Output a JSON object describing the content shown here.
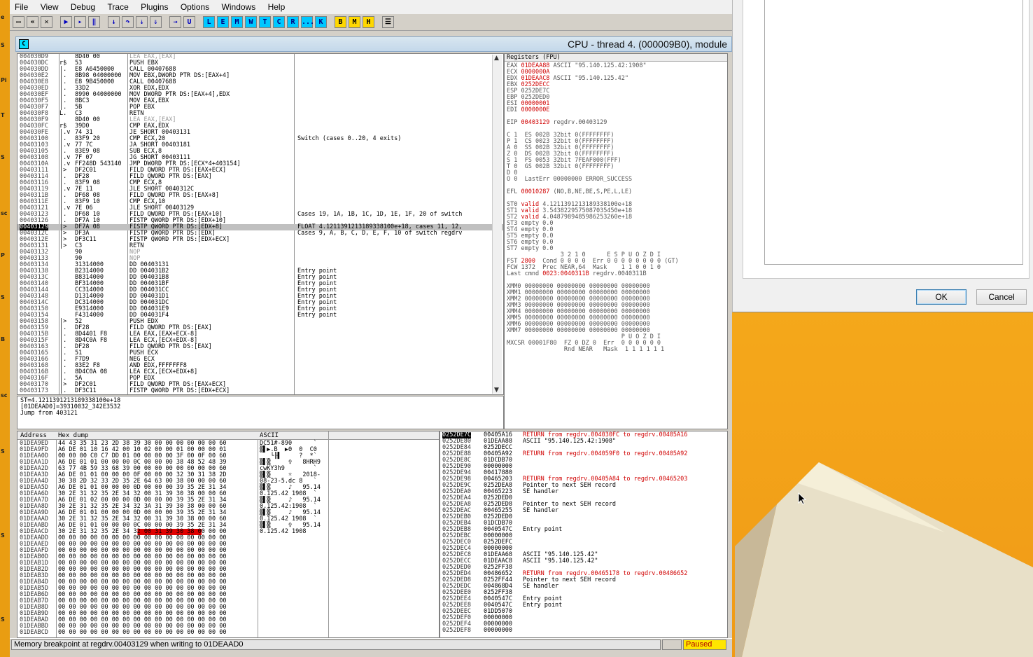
{
  "menu": [
    "File",
    "View",
    "Debug",
    "Trace",
    "Plugins",
    "Options",
    "Windows",
    "Help"
  ],
  "toolbar": {
    "letters": [
      "L",
      "E",
      "M",
      "W",
      "T",
      "C",
      "R",
      "...",
      "K"
    ],
    "letters2": [
      "B",
      "M",
      "H"
    ]
  },
  "window": {
    "icon_letter": "C",
    "title": "CPU - thread 4. (000009B0), module"
  },
  "disasm": [
    {
      "a": "004030D9",
      "m": "",
      "h": "8D40 00",
      "c": "LEA EAX,[EAX]",
      "n": "",
      "s": "grey"
    },
    {
      "a": "004030DC",
      "m": "r$",
      "h": "53",
      "c": "PUSH EBX",
      "n": ""
    },
    {
      "a": "004030DD",
      "m": "|.",
      "h": "E8 A6450000",
      "c": "CALL 00407688",
      "n": ""
    },
    {
      "a": "004030E2",
      "m": "|.",
      "h": "8B98 04000000",
      "c": "MOV EBX,DWORD PTR DS:[EAX+4]",
      "n": ""
    },
    {
      "a": "004030E8",
      "m": "|.",
      "h": "E8 9B450000",
      "c": "CALL 00407688",
      "n": ""
    },
    {
      "a": "004030ED",
      "m": "|.",
      "h": "33D2",
      "c": "XOR EDX,EDX",
      "n": ""
    },
    {
      "a": "004030EF",
      "m": "|.",
      "h": "8990 04000000",
      "c": "MOV DWORD PTR DS:[EAX+4],EDX",
      "n": ""
    },
    {
      "a": "004030F5",
      "m": "|.",
      "h": "8BC3",
      "c": "MOV EAX,EBX",
      "n": ""
    },
    {
      "a": "004030F7",
      "m": "|.",
      "h": "5B",
      "c": "POP EBX",
      "n": ""
    },
    {
      "a": "004030F8",
      "m": "L.",
      "h": "C3",
      "c": "RETN",
      "n": ""
    },
    {
      "a": "004030F9",
      "m": "",
      "h": "8D40 00",
      "c": "LEA EAX,[EAX]",
      "n": "",
      "s": "grey"
    },
    {
      "a": "004030FC",
      "m": "r$",
      "h": "39D0",
      "c": "CMP EAX,EDX",
      "n": ""
    },
    {
      "a": "004030FE",
      "m": "|.v",
      "h": "74 31",
      "c": "JE SHORT 00403131",
      "n": ""
    },
    {
      "a": "00403100",
      "m": "|.",
      "h": "83F9 20",
      "c": "CMP ECX,20",
      "n": "Switch (cases 0..20, 4 exits)"
    },
    {
      "a": "00403103",
      "m": "|.v",
      "h": "77 7C",
      "c": "JA SHORT 00403181",
      "n": ""
    },
    {
      "a": "00403105",
      "m": "|.",
      "h": "83E9 08",
      "c": "SUB ECX,8",
      "n": ""
    },
    {
      "a": "00403108",
      "m": "|.v",
      "h": "7F 07",
      "c": "JG SHORT 00403111",
      "n": ""
    },
    {
      "a": "0040310A",
      "m": "|.v",
      "h": "FF248D 543140",
      "c": "JMP DWORD PTR DS:[ECX*4+403154]",
      "n": ""
    },
    {
      "a": "00403111",
      "m": "|>",
      "h": "DF2C01",
      "c": "FILD QWORD PTR DS:[EAX+ECX]",
      "n": ""
    },
    {
      "a": "00403114",
      "m": "|.",
      "h": "DF28",
      "c": "FILD QWORD PTR DS:[EAX]",
      "n": ""
    },
    {
      "a": "00403116",
      "m": "|.",
      "h": "83F9 08",
      "c": "CMP ECX,8",
      "n": ""
    },
    {
      "a": "00403119",
      "m": "|.v",
      "h": "7E 11",
      "c": "JLE SHORT 0040312C",
      "n": ""
    },
    {
      "a": "0040311B",
      "m": "|.",
      "h": "DF68 08",
      "c": "FILD QWORD PTR DS:[EAX+8]",
      "n": ""
    },
    {
      "a": "0040311E",
      "m": "|.",
      "h": "83F9 10",
      "c": "CMP ECX,10",
      "n": ""
    },
    {
      "a": "00403121",
      "m": "|.v",
      "h": "7E 06",
      "c": "JLE SHORT 00403129",
      "n": ""
    },
    {
      "a": "00403123",
      "m": "|.",
      "h": "DF68 10",
      "c": "FILD QWORD PTR DS:[EAX+10]",
      "n": "Cases 19, 1A, 1B, 1C, 1D, 1E, 1F, 20 of switch"
    },
    {
      "a": "00403126",
      "m": "|.",
      "h": "DF7A 10",
      "c": "FISTP QWORD PTR DS:[EDX+10]",
      "n": ""
    },
    {
      "a": "00403129",
      "m": "|>",
      "h": "DF7A 08",
      "c": "FISTP QWORD PTR DS:[EDX+8]",
      "n": "FLOAT 4.1211391213189338100e+18, cases 11, 12,",
      "hl": true
    },
    {
      "a": "0040312C",
      "m": "|>",
      "h": "DF3A",
      "c": "FISTP QWORD PTR DS:[EDX]",
      "n": "Cases 9, A, B, C, D, E, F, 10 of switch regdrv"
    },
    {
      "a": "0040312E",
      "m": "|>",
      "h": "DF3C11",
      "c": "FISTP QWORD PTR DS:[EDX+ECX]",
      "n": ""
    },
    {
      "a": "00403131",
      "m": "|>",
      "h": "C3",
      "c": "RETN",
      "n": ""
    },
    {
      "a": "00403132",
      "m": "",
      "h": "90",
      "c": "NOP",
      "n": "",
      "s": "grey"
    },
    {
      "a": "00403133",
      "m": "",
      "h": "90",
      "c": "NOP",
      "n": "",
      "s": "grey"
    },
    {
      "a": "00403134",
      "m": "",
      "h": "31314000",
      "c": "DD 00403131",
      "n": ""
    },
    {
      "a": "00403138",
      "m": "",
      "h": "B2314000",
      "c": "DD 004031B2",
      "n": "Entry point"
    },
    {
      "a": "0040313C",
      "m": "",
      "h": "B8314000",
      "c": "DD 004031B8",
      "n": "Entry point"
    },
    {
      "a": "00403140",
      "m": "",
      "h": "BF314000",
      "c": "DD 004031BF",
      "n": "Entry point"
    },
    {
      "a": "00403144",
      "m": "",
      "h": "CC314000",
      "c": "DD 004031CC",
      "n": "Entry point"
    },
    {
      "a": "00403148",
      "m": "",
      "h": "D1314000",
      "c": "DD 004031D1",
      "n": "Entry point"
    },
    {
      "a": "0040314C",
      "m": "",
      "h": "DC314000",
      "c": "DD 004031DC",
      "n": "Entry point"
    },
    {
      "a": "00403150",
      "m": "",
      "h": "E9314000",
      "c": "DD 004031E9",
      "n": "Entry point"
    },
    {
      "a": "00403154",
      "m": "",
      "h": "F4314000",
      "c": "DD 004031F4",
      "n": "Entry point"
    },
    {
      "a": "00403158",
      "m": "|>",
      "h": "52",
      "c": "PUSH EDX",
      "n": ""
    },
    {
      "a": "00403159",
      "m": "|.",
      "h": "DF28",
      "c": "FILD QWORD PTR DS:[EAX]",
      "n": ""
    },
    {
      "a": "0040315B",
      "m": "|.",
      "h": "8D4401 F8",
      "c": "LEA EAX,[EAX+ECX-8]",
      "n": ""
    },
    {
      "a": "0040315F",
      "m": "|.",
      "h": "8D4C0A F8",
      "c": "LEA ECX,[ECX+EDX-8]",
      "n": ""
    },
    {
      "a": "00403163",
      "m": "|.",
      "h": "DF28",
      "c": "FILD QWORD PTR DS:[EAX]",
      "n": ""
    },
    {
      "a": "00403165",
      "m": "|.",
      "h": "51",
      "c": "PUSH ECX",
      "n": ""
    },
    {
      "a": "00403166",
      "m": "|.",
      "h": "F7D9",
      "c": "NEG ECX",
      "n": ""
    },
    {
      "a": "00403168",
      "m": "|.",
      "h": "83E2 F8",
      "c": "AND EDX,FFFFFFF8",
      "n": ""
    },
    {
      "a": "0040316B",
      "m": "|.",
      "h": "8D4C0A 08",
      "c": "LEA ECX,[ECX+EDX+8]",
      "n": ""
    },
    {
      "a": "0040316F",
      "m": "|.",
      "h": "5A",
      "c": "POP EDX",
      "n": ""
    },
    {
      "a": "00403170",
      "m": "|>",
      "h": "DF2C01",
      "c": "FILD QWORD PTR DS:[EAX+ECX]",
      "n": ""
    },
    {
      "a": "00403173",
      "m": "|.",
      "h": "DF3C11",
      "c": "FISTP QWORD PTR DS:[EDX+ECX]",
      "n": ""
    }
  ],
  "info": [
    "ST=4.1211391213189338100e+18",
    "[01DEAAD0]=39310032_342E3532",
    "Jump from 403121"
  ],
  "registers": {
    "header": "Registers (FPU)",
    "lines": [
      {
        "t": "EAX ",
        "v": "01DEAA88",
        "r": " ASCII \"95.140.125.42:1908\""
      },
      {
        "t": "ECX ",
        "v": "0000000A",
        "r": ""
      },
      {
        "t": "EDX ",
        "v": "01DEAAC8",
        "r": " ASCII \"95.140.125.42\""
      },
      {
        "t": "EBX ",
        "v": "0252DECC",
        "r": ""
      },
      {
        "t": "ESP 0252DE7C",
        "v": "",
        "r": ""
      },
      {
        "t": "EBP 0252DED0",
        "v": "",
        "r": ""
      },
      {
        "t": "ESI ",
        "v": "00000001",
        "r": ""
      },
      {
        "t": "EDI ",
        "v": "0000000E",
        "r": ""
      },
      {
        "t": "",
        "v": "",
        "r": ""
      },
      {
        "t": "EIP ",
        "v": "00403129",
        "r": " regdrv.00403129"
      },
      {
        "t": "",
        "v": "",
        "r": ""
      },
      {
        "t": "C 1  ES 002B 32bit 0(FFFFFFFF)",
        "v": "",
        "r": ""
      },
      {
        "t": "P 1  CS 0023 32bit 0(FFFFFFFF)",
        "v": "",
        "r": ""
      },
      {
        "t": "A 0  SS 002B 32bit 0(FFFFFFFF)",
        "v": "",
        "r": ""
      },
      {
        "t": "Z 0  DS 002B 32bit 0(FFFFFFFF)",
        "v": "",
        "r": ""
      },
      {
        "t": "S 1  FS 0053 32bit 7FEAF000(FFF)",
        "v": "",
        "r": ""
      },
      {
        "t": "T 0  GS 002B 32bit 0(FFFFFFFF)",
        "v": "",
        "r": ""
      },
      {
        "t": "D 0",
        "v": "",
        "r": ""
      },
      {
        "t": "O 0  LastErr 00000000 ERROR_SUCCESS",
        "v": "",
        "r": ""
      },
      {
        "t": "",
        "v": "",
        "r": ""
      },
      {
        "t": "EFL ",
        "v": "00010287",
        "r": " (NO,B,NE,BE,S,PE,L,LE)"
      },
      {
        "t": "",
        "v": "",
        "r": ""
      },
      {
        "t": "ST0 ",
        "v": "valid",
        "r": " 4.1211391213189338100e+18"
      },
      {
        "t": "ST1 ",
        "v": "valid",
        "r": " 3.5438229575087035450e+18"
      },
      {
        "t": "ST2 ",
        "v": "valid",
        "r": " 4.0487989485986253260e+18"
      },
      {
        "t": "ST3 empty 0.0",
        "v": "",
        "r": ""
      },
      {
        "t": "ST4 empty 0.0",
        "v": "",
        "r": ""
      },
      {
        "t": "ST5 empty 0.0",
        "v": "",
        "r": ""
      },
      {
        "t": "ST6 empty 0.0",
        "v": "",
        "r": ""
      },
      {
        "t": "ST7 empty 0.0",
        "v": "",
        "r": ""
      },
      {
        "t": "               3 2 1 0      E S P U O Z D I",
        "v": "",
        "r": ""
      },
      {
        "t": "FST ",
        "v": "2800",
        "r": "  Cond 0 0 0 0  Err 0 0 0 0 0 0 0 0 (GT)"
      },
      {
        "t": "FCW 1372  Prec NEAR,64  Mask    1 1 0 0 1 0",
        "v": "",
        "r": ""
      },
      {
        "t": "Last cmnd ",
        "v": "0023:0040311B",
        "r": " regdrv.0040311B"
      },
      {
        "t": "",
        "v": "",
        "r": ""
      },
      {
        "t": "XMM0 00000000 00000000 00000000 00000000",
        "v": "",
        "r": ""
      },
      {
        "t": "XMM1 00000000 00000000 00000000 00000000",
        "v": "",
        "r": ""
      },
      {
        "t": "XMM2 00000000 00000000 00000000 00000000",
        "v": "",
        "r": ""
      },
      {
        "t": "XMM3 00000000 00000000 00000000 00000000",
        "v": "",
        "r": ""
      },
      {
        "t": "XMM4 00000000 00000000 00000000 00000000",
        "v": "",
        "r": ""
      },
      {
        "t": "XMM5 00000000 00000000 00000000 00000000",
        "v": "",
        "r": ""
      },
      {
        "t": "XMM6 00000000 00000000 00000000 00000000",
        "v": "",
        "r": ""
      },
      {
        "t": "XMM7 00000000 00000000 00000000 00000000",
        "v": "",
        "r": ""
      },
      {
        "t": "                                P U O Z D I",
        "v": "",
        "r": ""
      },
      {
        "t": "MXCSR 00001F80  FZ 0 DZ 0  Err  0 0 0 0 0 0",
        "v": "",
        "r": ""
      },
      {
        "t": "                Rnd NEAR   Mask  1 1 1 1 1 1",
        "v": "",
        "r": ""
      }
    ]
  },
  "dump": {
    "headers": [
      "Address",
      "Hex dump",
      "ASCII"
    ],
    "rows": [
      {
        "a": "01DEA9ED",
        "h": "44 43 35 31 23 2D 38 39 30 00 00 00 00 00 00 60",
        "x": "DC51#-890      `"
      },
      {
        "a": "01DEA9FD",
        "h": "A6 DE 01 10 16 42 00 10 02 00 00 01 00 00 00 01",
        "x": "▒▌▶.B  ▶Θ  0  C0"
      },
      {
        "a": "01DEAA0D",
        "h": "00 00 00 C0 C7 DD 01 00 00 00 00 3F 00 0F 00 60",
        "x": "   └╟▌     ?  *`"
      },
      {
        "a": "01DEAA1D",
        "h": "A6 DE 01 01 00 00 00 0C 00 00 00 38 48 52 48 39",
        "x": "▒▌▒     ♀   8HRH9"
      },
      {
        "a": "01DEAA2D",
        "h": "63 77 4B 59 33 68 39 00 00 00 00 00 00 00 00 60",
        "x": "cwKY3h9        `"
      },
      {
        "a": "01DEAA3D",
        "h": "A6 DE 01 01 00 00 00 0F 00 00 00 32 30 31 38 2D",
        "x": "▒▌▒     ☼   2018-"
      },
      {
        "a": "01DEAA4D",
        "h": "30 38 2D 32 33 2D 35 2E 64 63 00 38 00 00 00 60",
        "x": "08-23-5.dc 8   `"
      },
      {
        "a": "01DEAA5D",
        "h": "A6 DE 01 01 00 00 00 0D 00 00 00 39 35 2E 31 34",
        "x": "▒▌▒     ♪   95.14"
      },
      {
        "a": "01DEAA6D",
        "h": "30 2E 31 32 35 2E 34 32 00 31 39 30 38 00 00 60",
        "x": "0.125.42 1908  `"
      },
      {
        "a": "01DEAA7D",
        "h": "A6 DE 01 02 00 00 00 0D 00 00 00 39 35 2E 31 34",
        "x": "▒▌▒     ♪   95.14"
      },
      {
        "a": "01DEAA8D",
        "h": "30 2E 31 32 35 2E 34 32 3A 31 39 30 38 00 00 60",
        "x": "0.125.42:1908  `"
      },
      {
        "a": "01DEAA9D",
        "h": "A6 DE 01 01 00 00 00 0D 00 00 00 39 35 2E 31 34",
        "x": "▒▌▒     ♪   95.14"
      },
      {
        "a": "01DEAAAD",
        "h": "30 2E 31 32 35 2E 34 32 00 31 39 30 38 00 00 60",
        "x": "0.125.42 1908  `"
      },
      {
        "a": "01DEAABD",
        "h": "A6 DE 01 01 00 00 00 0C 00 00 00 39 35 2E 31 34",
        "x": "▒▌▒     ♀   95.14"
      },
      {
        "a": "01DEAACD",
        "h": "30 2E 31 32 35 2E 34 32 00 31 39 30 38 00 00 00",
        "x": "0.125.42 1908   "
      },
      {
        "a": "01DEAADD",
        "h": "00 00 00 00 00 00 00 00 00 00 00 00 00 00 00 00",
        "x": ""
      },
      {
        "a": "01DEAAED",
        "h": "00 00 00 00 00 00 00 00 00 00 00 00 00 00 00 00",
        "x": ""
      },
      {
        "a": "01DEAAFD",
        "h": "00 00 00 00 00 00 00 00 00 00 00 00 00 00 00 00",
        "x": ""
      },
      {
        "a": "01DEAB0D",
        "h": "00 00 00 00 00 00 00 00 00 00 00 00 00 00 00 00",
        "x": ""
      },
      {
        "a": "01DEAB1D",
        "h": "00 00 00 00 00 00 00 00 00 00 00 00 00 00 00 00",
        "x": ""
      },
      {
        "a": "01DEAB2D",
        "h": "00 00 00 00 00 00 00 00 00 00 00 00 00 00 00 00",
        "x": ""
      },
      {
        "a": "01DEAB3D",
        "h": "00 00 00 00 00 00 00 00 00 00 00 00 00 00 00 00",
        "x": ""
      },
      {
        "a": "01DEAB4D",
        "h": "00 00 00 00 00 00 00 00 00 00 00 00 00 00 00 00",
        "x": ""
      },
      {
        "a": "01DEAB5D",
        "h": "00 00 00 00 00 00 00 00 00 00 00 00 00 00 00 00",
        "x": ""
      },
      {
        "a": "01DEAB6D",
        "h": "00 00 00 00 00 00 00 00 00 00 00 00 00 00 00 00",
        "x": ""
      },
      {
        "a": "01DEAB7D",
        "h": "00 00 00 00 00 00 00 00 00 00 00 00 00 00 00 00",
        "x": ""
      },
      {
        "a": "01DEAB8D",
        "h": "00 00 00 00 00 00 00 00 00 00 00 00 00 00 00 00",
        "x": ""
      },
      {
        "a": "01DEAB9D",
        "h": "00 00 00 00 00 00 00 00 00 00 00 00 00 00 00 00",
        "x": ""
      },
      {
        "a": "01DEABAD",
        "h": "00 00 00 00 00 00 00 00 00 00 00 00 00 00 00 00",
        "x": ""
      },
      {
        "a": "01DEABBD",
        "h": "00 00 00 00 00 00 00 00 00 00 00 00 00 00 00 00",
        "x": ""
      },
      {
        "a": "01DEABCD",
        "h": "00 00 00 00 00 00 00 00 00 00 00 00 00 00 00 00",
        "x": ""
      }
    ]
  },
  "stack": [
    {
      "a": "0252DE7C",
      "v": "00405A16",
      "c": "RETURN from regdrv.004030FC to regdrv.00405A16",
      "red": true,
      "hl": true
    },
    {
      "a": "0252DE80",
      "v": "01DEAA88",
      "c": "ASCII \"95.140.125.42:1908\""
    },
    {
      "a": "0252DE84",
      "v": "0252DECC",
      "c": ""
    },
    {
      "a": "0252DE88",
      "v": "00405A92",
      "c": "RETURN from regdrv.004059F0 to regdrv.00405A92",
      "red": true
    },
    {
      "a": "0252DE8C",
      "v": "01DCDB70",
      "c": ""
    },
    {
      "a": "0252DE90",
      "v": "00000000",
      "c": ""
    },
    {
      "a": "0252DE94",
      "v": "00417880",
      "c": ""
    },
    {
      "a": "0252DE98",
      "v": "00465203",
      "c": "RETURN from regdrv.00405A84 to regdrv.00465203",
      "red": true
    },
    {
      "a": "0252DE9C",
      "v": "0252DEA8",
      "c": "Pointer to next SEH record"
    },
    {
      "a": "0252DEA0",
      "v": "00465223",
      "c": "SE handler"
    },
    {
      "a": "0252DEA4",
      "v": "0252DED0",
      "c": ""
    },
    {
      "a": "0252DEA8",
      "v": "0252DED8",
      "c": "Pointer to next SEH record"
    },
    {
      "a": "0252DEAC",
      "v": "00465255",
      "c": "SE handler"
    },
    {
      "a": "0252DEB0",
      "v": "0252DED0",
      "c": ""
    },
    {
      "a": "0252DEB4",
      "v": "01DCDB70",
      "c": ""
    },
    {
      "a": "0252DEB8",
      "v": "0040547C",
      "c": "Entry point"
    },
    {
      "a": "0252DEBC",
      "v": "00000000",
      "c": ""
    },
    {
      "a": "0252DEC0",
      "v": "0252DEFC",
      "c": ""
    },
    {
      "a": "0252DEC4",
      "v": "00000000",
      "c": ""
    },
    {
      "a": "0252DEC8",
      "v": "01DEAA68",
      "c": "ASCII \"95.140.125.42\""
    },
    {
      "a": "0252DECC",
      "v": "01DEAAC8",
      "c": "ASCII \"95.140.125.42\""
    },
    {
      "a": "0252DED0",
      "v": "0252FF38",
      "c": ""
    },
    {
      "a": "0252DED4",
      "v": "00486652",
      "c": "RETURN from regdrv.00465178 to regdrv.00486652",
      "red": true
    },
    {
      "a": "0252DED8",
      "v": "0252FF44",
      "c": "Pointer to next SEH record"
    },
    {
      "a": "0252DEDC",
      "v": "004868D4",
      "c": "SE handler"
    },
    {
      "a": "0252DEE0",
      "v": "0252FF38",
      "c": ""
    },
    {
      "a": "0252DEE4",
      "v": "0040547C",
      "c": "Entry point"
    },
    {
      "a": "0252DEE8",
      "v": "0040547C",
      "c": "Entry point"
    },
    {
      "a": "0252DEEC",
      "v": "01DD5070",
      "c": ""
    },
    {
      "a": "0252DEF0",
      "v": "00000000",
      "c": ""
    },
    {
      "a": "0252DEF4",
      "v": "00000000",
      "c": ""
    },
    {
      "a": "0252DEF8",
      "v": "00000000",
      "c": ""
    }
  ],
  "status": {
    "message": "Memory breakpoint at regdrv.00403129 when writing to 01DEAAD0",
    "state": "Paused"
  },
  "dialog": {
    "ok_label": "OK",
    "cancel_label": "Cancel"
  }
}
